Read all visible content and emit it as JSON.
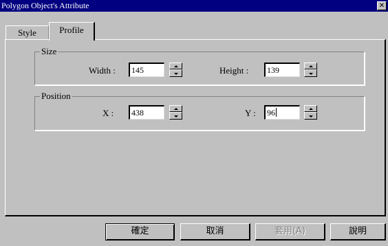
{
  "window": {
    "title": "Polygon Object's Attribute",
    "close_glyph": "✕"
  },
  "tabs": [
    {
      "label": "Style",
      "active": false
    },
    {
      "label": "Profile",
      "active": true
    }
  ],
  "size_group": {
    "legend": "Size",
    "width_label": "Width :",
    "width_value": "145",
    "height_label": "Height :",
    "height_value": "139"
  },
  "position_group": {
    "legend": "Position",
    "x_label": "X :",
    "x_value": "438",
    "y_label": "Y :",
    "y_value": "96"
  },
  "buttons": {
    "ok": "確定",
    "cancel": "取消",
    "apply": "套用(A)",
    "help": "說明"
  },
  "icons": {
    "close": "close-icon",
    "spin_up": "arrow-up-icon",
    "spin_down": "arrow-down-icon"
  },
  "colors": {
    "titlebar": "#000080",
    "face": "#c0c0c0",
    "disabled_text": "#808080"
  }
}
